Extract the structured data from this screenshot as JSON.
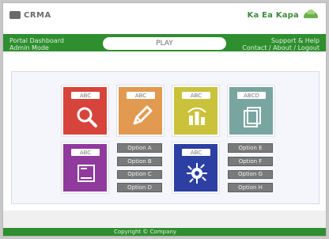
{
  "header": {
    "brand_left": "CRMA",
    "brand_right": "Ka Ea Kapa"
  },
  "green_bar": {
    "left_line1": "Portal Dashboard",
    "left_line2": "Admin Mode",
    "right_line1": "Support & Help",
    "right_line2": "Contact / About / Logout",
    "active_tab": "PLAY"
  },
  "tiles": [
    {
      "id": "search",
      "caption": "ABC",
      "color": "#d7443c",
      "icon": "search-icon"
    },
    {
      "id": "edit",
      "caption": "ABC",
      "color": "#e29a50",
      "icon": "pencil-icon"
    },
    {
      "id": "reports",
      "caption": "ABC",
      "color": "#c9c23a",
      "icon": "bar-chart-icon"
    },
    {
      "id": "archive",
      "caption": "ABCD",
      "color": "#79a5a1",
      "icon": "file-stack-icon"
    },
    {
      "id": "files",
      "caption": "ABC",
      "color": "#8f3a9c",
      "icon": "file-icon"
    },
    {
      "id": "settings",
      "caption": "ABC",
      "color": "#2c3fa3",
      "icon": "gear-icon"
    }
  ],
  "grey_buttons_left": [
    "Option A",
    "Option B",
    "Option C",
    "Option D"
  ],
  "grey_buttons_right": [
    "Option E",
    "Option F",
    "Option G",
    "Option H"
  ],
  "footer": {
    "text": "Copyright © Company"
  }
}
